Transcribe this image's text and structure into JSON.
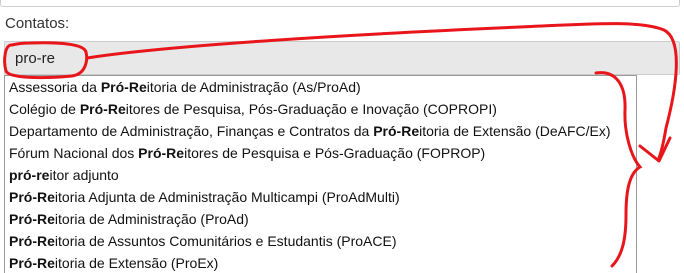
{
  "field": {
    "label": "Contatos:",
    "value": "pro-re",
    "highlight_query": "Pró-Re"
  },
  "options": [
    {
      "before": "Assessoria da ",
      "match": "Pró-Re",
      "after": "itoria de Administração (As/ProAd)"
    },
    {
      "before": "Colégio de ",
      "match": "Pró-Re",
      "after": "itores de Pesquisa, Pós-Graduação e Inovação (COPROPI)"
    },
    {
      "before": "Departamento de Administração, Finanças e Contratos da ",
      "match": "Pró-Re",
      "after": "itoria de Extensão (DeAFC/Ex)"
    },
    {
      "before": "Fórum Nacional dos ",
      "match": "Pró-Re",
      "after": "itores de Pesquisa e Pós-Graduação (FOPROP)"
    },
    {
      "before": "",
      "match": "pró-re",
      "after": "itor adjunto"
    },
    {
      "before": "",
      "match": "Pró-Re",
      "after": "itoria Adjunta de Administração Multicampi (ProAdMulti)"
    },
    {
      "before": "",
      "match": "Pró-Re",
      "after": "itoria de Administração (ProAd)"
    },
    {
      "before": "",
      "match": "Pró-Re",
      "after": "itoria de Assuntos Comunitários e Estudantis (ProACE)"
    },
    {
      "before": "",
      "match": "Pró-Re",
      "after": "itoria de Extensão (ProEx)"
    }
  ],
  "colors": {
    "annotation": "#e8161b",
    "input_bg": "#e8e8e8"
  }
}
